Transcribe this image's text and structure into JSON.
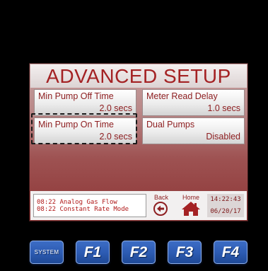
{
  "screen": {
    "title": "ADVANCED SETUP"
  },
  "fields": {
    "min_pump_off": {
      "label": "Min Pump Off Time",
      "value": "2.0 secs"
    },
    "meter_read_delay": {
      "label": "Meter Read Delay",
      "value": "1.0 secs"
    },
    "min_pump_on": {
      "label": "Min Pump On Time",
      "value": "2.0 secs"
    },
    "dual_pumps": {
      "label": "Dual Pumps",
      "value": "Disabled"
    }
  },
  "messages": [
    "08:22 Analog Gas Flow",
    "08:22 Constant Rate Mode"
  ],
  "nav": {
    "back_label": "Back",
    "home_label": "Home"
  },
  "clock": {
    "time": "14:22:43",
    "date": "06/20/17"
  },
  "function_keys": {
    "system": "SYSTEM",
    "f1": "F1",
    "f2": "F2",
    "f3": "F3",
    "f4": "F4"
  },
  "colors": {
    "accent": "#a42224",
    "key_blue": "#2d5cb4"
  }
}
